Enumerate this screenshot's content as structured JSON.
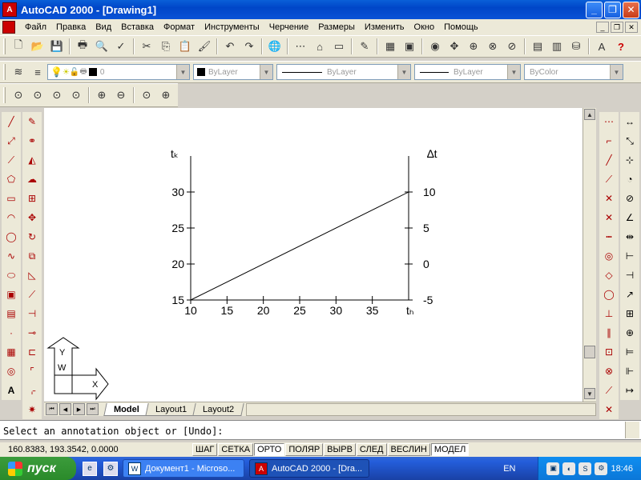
{
  "window": {
    "title": "AutoCAD 2000 - [Drawing1]"
  },
  "menu": [
    "Файл",
    "Правка",
    "Вид",
    "Вставка",
    "Формат",
    "Инструменты",
    "Черчение",
    "Размеры",
    "Изменить",
    "Окно",
    "Помощь"
  ],
  "properties_bar": {
    "layer_value": "0",
    "color_value": "ByLayer",
    "linetype_value": "ByLayer",
    "lineweight_value": "ByLayer",
    "plotstyle_value": "ByColor"
  },
  "drawing": {
    "left_axis_label": "tₖ",
    "right_axis_label": "∆t",
    "x_axis_label": "tₕ",
    "x_ticks": [
      "10",
      "15",
      "20",
      "25",
      "30",
      "35"
    ],
    "y_left_ticks": [
      "15",
      "20",
      "25",
      "30"
    ],
    "y_right_ticks": [
      "-5",
      "0",
      "5",
      "10"
    ],
    "ucs_x_label": "X",
    "ucs_y_label": "Y",
    "ucs_w_label": "W"
  },
  "chart_data": {
    "type": "line",
    "title": "",
    "xlabel": "tₕ",
    "ylabel": "tₖ",
    "y2label": "∆t",
    "xlim": [
      10,
      40
    ],
    "ylim": [
      15,
      35
    ],
    "y2lim": [
      -5,
      15
    ],
    "grid": false,
    "series": [
      {
        "x": [
          10,
          40
        ],
        "y": [
          15,
          30
        ]
      }
    ]
  },
  "tabs": [
    "Model",
    "Layout1",
    "Layout2"
  ],
  "command_line": {
    "text": "Select an annotation object or [Undo]:"
  },
  "status": {
    "coordinates": "160.8383, 193.3542, 0.0000",
    "buttons": [
      {
        "label": "ШАГ",
        "on": false
      },
      {
        "label": "СЕТКА",
        "on": false
      },
      {
        "label": "ОРТО",
        "on": true
      },
      {
        "label": "ПОЛЯР",
        "on": false
      },
      {
        "label": "ВЫРВ",
        "on": false
      },
      {
        "label": "СЛЕД",
        "on": false
      },
      {
        "label": "ВЕСЛИН",
        "on": false
      },
      {
        "label": "МОДЕЛ",
        "on": true
      }
    ]
  },
  "taskbar": {
    "start_label": "пуск",
    "tasks": [
      "Документ1 - Microso...",
      "AutoCAD 2000 - [Dra..."
    ],
    "language": "EN",
    "clock": "18:46"
  }
}
